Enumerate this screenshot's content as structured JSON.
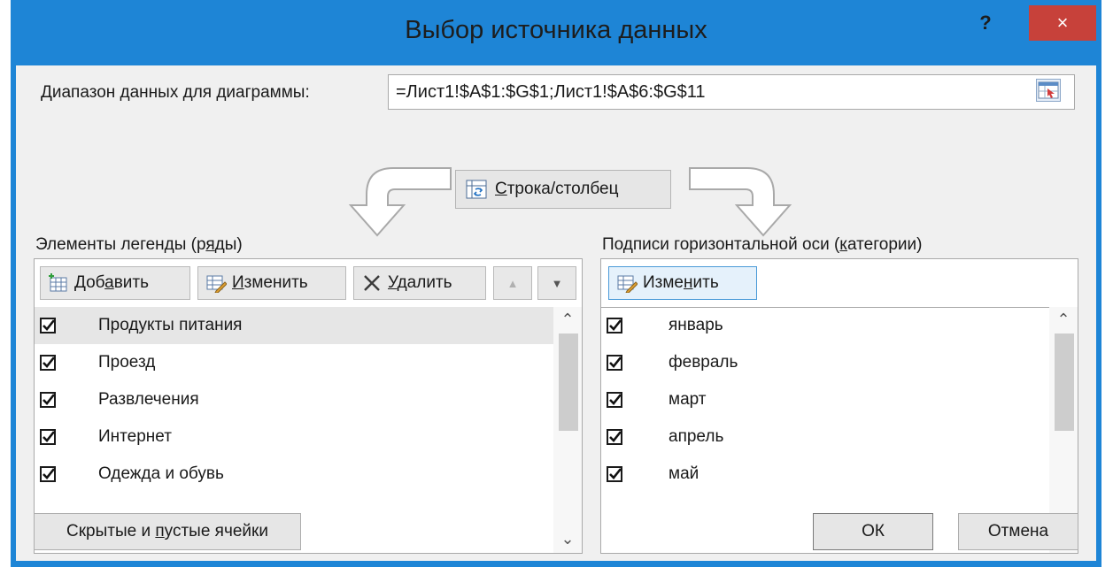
{
  "window": {
    "title": "Выбор источника данных",
    "help_label": "?",
    "close_label": "×"
  },
  "range": {
    "label": "Диапазон данных для диаграммы:",
    "value": "=Лист1!$A$1:$G$1;Лист1!$A$6:$G$11"
  },
  "swap_button": {
    "label": "Строка/столбец"
  },
  "legend": {
    "heading": "Элементы легенды (ряды)",
    "toolbar": {
      "add_label": "Добавить",
      "edit_label": "Изменить",
      "delete_label": "Удалить",
      "up_label": "▲",
      "down_label": "▼"
    },
    "items": [
      {
        "label": "Продукты питания",
        "checked": true,
        "selected": true
      },
      {
        "label": "Проезд",
        "checked": true,
        "selected": false
      },
      {
        "label": "Развлечения",
        "checked": true,
        "selected": false
      },
      {
        "label": "Интернет",
        "checked": true,
        "selected": false
      },
      {
        "label": "Одежда и обувь",
        "checked": true,
        "selected": false
      }
    ]
  },
  "axis": {
    "heading": "Подписи горизонтальной оси (категории)",
    "toolbar": {
      "edit_label": "Изменить"
    },
    "items": [
      {
        "label": "январь",
        "checked": true
      },
      {
        "label": "февраль",
        "checked": true
      },
      {
        "label": "март",
        "checked": true
      },
      {
        "label": "апрель",
        "checked": true
      },
      {
        "label": "май",
        "checked": true
      }
    ]
  },
  "footer": {
    "hidden_cells_label": "Скрытые и пустые ячейки",
    "ok_label": "ОК",
    "cancel_label": "Отмена"
  },
  "colors": {
    "title_bar": "#1e85d6",
    "close_button": "#c7413a",
    "dialog_body": "#f0f0f0"
  }
}
